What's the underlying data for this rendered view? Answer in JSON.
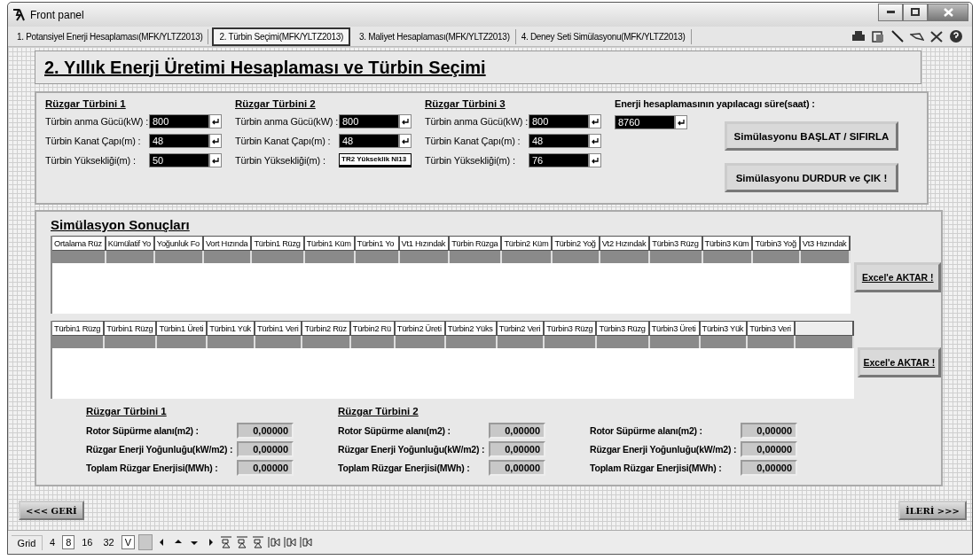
{
  "window": {
    "title": "Front panel"
  },
  "tabs": [
    {
      "label": "1. Potansiyel Enerji Hesaplaması(MFK/YLTZ2013)",
      "selected": false
    },
    {
      "label": "2. Türbin Seçimi(MFK/YLTZ2013)",
      "selected": true
    },
    {
      "label": "3. Maliyet Hesaplaması(MFK/YLTZ2013)",
      "selected": false
    },
    {
      "label": "4. Deney Seti Simülasyonu(MFK/YLTZ2013)",
      "selected": false
    }
  ],
  "heading": "2. Yıllık Enerji Üretimi Hesaplaması ve Türbin Seçimi",
  "turbines": [
    {
      "title": "Rüzgar Türbini 1",
      "fields": [
        {
          "label": "Türbin anma Gücü(kW) :",
          "value": "800",
          "kind": "input"
        },
        {
          "label": "Türbin Kanat Çapı(m) :",
          "value": "48",
          "kind": "input"
        },
        {
          "label": "Türbin Yüksekliği(m) :",
          "value": "50",
          "kind": "input"
        }
      ]
    },
    {
      "title": "Rüzgar Türbini 2",
      "fields": [
        {
          "label": "Türbin anma Gücü(kW) :",
          "value": "800",
          "kind": "input"
        },
        {
          "label": "Türbin Kanat Çapı(m) :",
          "value": "48",
          "kind": "input"
        },
        {
          "label": "Türbin Yüksekliği(m) :",
          "value": "TR2 Yükseklik NI13",
          "kind": "tag"
        }
      ]
    },
    {
      "title": "Rüzgar Türbini 3",
      "fields": [
        {
          "label": "Türbin anma Gücü(kW) :",
          "value": "800",
          "kind": "input"
        },
        {
          "label": "Türbin Kanat Çapı(m) :",
          "value": "48",
          "kind": "input"
        },
        {
          "label": "Türbin Yüksekliği(m) :",
          "value": "76",
          "kind": "input"
        }
      ]
    }
  ],
  "duration": {
    "label": "Enerji hesaplamasının yapılacagı süre(saat) :",
    "value": "8760"
  },
  "sim_buttons": [
    "Simülasyonu BAŞLAT / SIFIRLA",
    "Simülasyonu DURDUR ve ÇIK !"
  ],
  "results": {
    "title": "Simülasyon Sonuçları",
    "tables": [
      {
        "columns": [
          "Ortalama Rüz",
          "Kümülatif Yo",
          "Yoğunluk Fo",
          "Vort Hızında",
          "Türbin1 Rüzg",
          "Türbin1 Küm",
          "Türbin1 Yo",
          "Vt1 Hızındak",
          "Türbin Rüzga",
          "Türbin2 Küm",
          "Türbin2 Yoğ",
          "Vt2 Hızındak",
          "Türbin3 Rüzg",
          "Türbin3 Küm",
          "Türbin3 Yoğ",
          "Vt3 Hızındak"
        ],
        "export_button": "Excel'e AKTAR !"
      },
      {
        "columns": [
          "Türbin1 Rüzg",
          "Türbin1 Rüzg",
          "Türbin1 Üreti",
          "Türbin1 Yük",
          "Türbin1 Veri",
          "Türbin2 Rüz",
          "Türbin2 Rü",
          "Türbin2 Üreti",
          "Türbin2 Yüks",
          "Türbin2 Veri",
          "Türbin3 Rüzg",
          "Türbin3 Rüzg",
          "Türbin3 Üreti",
          "Türbin3  Yük",
          "Türbin3 Veri"
        ],
        "export_button": "Excel'e AKTAR !"
      }
    ],
    "summaries": [
      {
        "title": "Rüzgar Türbini 1",
        "rows": [
          {
            "label": "Rotor Süpürme alanı(m2) :",
            "value": "0,00000"
          },
          {
            "label": "Rüzgar Enerji Yoğunluğu(kW/m2) :",
            "value": "0,00000"
          },
          {
            "label": "Toplam Rüzgar Enerjisi(MWh) :",
            "value": "0,00000"
          }
        ]
      },
      {
        "title": "Rüzgar Türbini 2",
        "rows": [
          {
            "label": "Rotor Süpürme alanı(m2) :",
            "value": "0,00000"
          },
          {
            "label": "Rüzgar Enerji Yoğunluğu(kW/m2) :",
            "value": "0,00000"
          },
          {
            "label": "Toplam Rüzgar Enerjisi(MWh) :",
            "value": "0,00000"
          }
        ]
      },
      {
        "rows": [
          {
            "label": "Rotor Süpürme alanı(m2) :",
            "value": "0,00000"
          },
          {
            "label": "Rüzgar Enerji Yoğunluğu(kW/m2) :",
            "value": "0,00000"
          },
          {
            "label": "Toplam Rüzgar Enerjisi(MWh) :",
            "value": "0,00000"
          }
        ]
      }
    ]
  },
  "nav": {
    "back": "<<< GERİ",
    "next": "İLERİ >>>"
  },
  "grid_bar": {
    "label": "Grid",
    "sizes": [
      {
        "label": "4",
        "selected": false
      },
      {
        "label": "8",
        "selected": true
      },
      {
        "label": "16",
        "selected": false
      },
      {
        "label": "32",
        "selected": false
      }
    ],
    "v_label": "V"
  }
}
